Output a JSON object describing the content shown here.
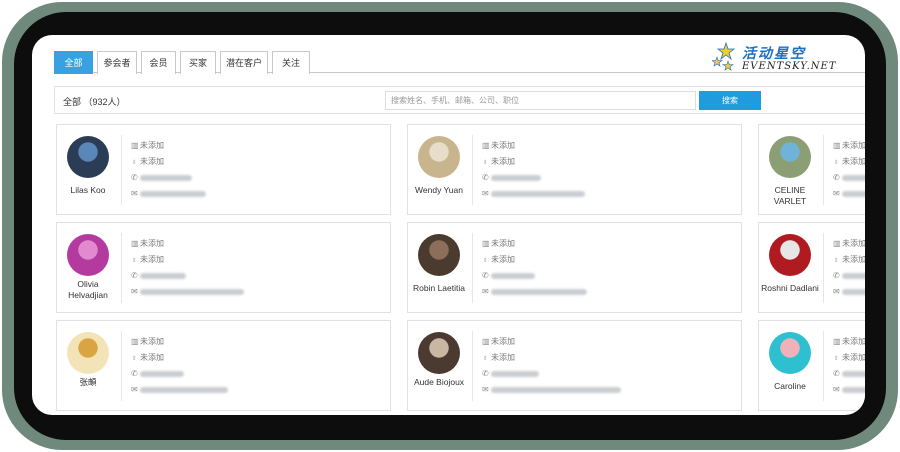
{
  "tabs": [
    {
      "label": "全部",
      "active": true
    },
    {
      "label": "参会者",
      "active": false
    },
    {
      "label": "会员",
      "active": false
    },
    {
      "label": "买家",
      "active": false
    },
    {
      "label": "潜在客户",
      "active": false
    },
    {
      "label": "关注",
      "active": false
    }
  ],
  "logo": {
    "cn": "活动星空",
    "en": "EVENTSKY.NET"
  },
  "filter": {
    "label": "全部 （932人）",
    "search_placeholder": "搜索姓名、手机、邮箱、公司、职位",
    "search_button": "搜索"
  },
  "contacts": [
    {
      "name": "Lilas Koo",
      "company": "未添加",
      "title": "未添加",
      "avatar_colors": [
        "#2b3d55",
        "#5a86b8"
      ]
    },
    {
      "name": "Wendy Yuan",
      "company": "未添加",
      "title": "未添加",
      "avatar_colors": [
        "#c9b58d",
        "#e7ddc8"
      ]
    },
    {
      "name": "CELINE VARLET",
      "company": "未添加",
      "title": "未添加",
      "avatar_colors": [
        "#8c9f74",
        "#6fb3d8"
      ]
    },
    {
      "name": "Olivia Helvadjian",
      "company": "未添加",
      "title": "未添加",
      "avatar_colors": [
        "#b43aa0",
        "#e28ad0"
      ]
    },
    {
      "name": "Robin Laetitia",
      "company": "未添加",
      "title": "未添加",
      "avatar_colors": [
        "#4b3a2e",
        "#8c6f5a"
      ]
    },
    {
      "name": "Roshni Dadlani",
      "company": "未添加",
      "title": "未添加",
      "avatar_colors": [
        "#b01b22",
        "#e6e6e6"
      ]
    },
    {
      "name": "张頔",
      "company": "未添加",
      "title": "未添加",
      "avatar_colors": [
        "#f3e4b8",
        "#d9a441"
      ]
    },
    {
      "name": "Aude Biojoux",
      "company": "未添加",
      "title": "未添加",
      "avatar_colors": [
        "#4a3a30",
        "#c9b7a4"
      ]
    },
    {
      "name": "Caroline",
      "company": "未添加",
      "title": "未添加",
      "avatar_colors": [
        "#2ec0d0",
        "#f0b2b8"
      ]
    }
  ],
  "colors": {
    "frame": "#6f8a7c",
    "accent": "#1e9cdd",
    "active_tab": "#3aa1e0"
  }
}
